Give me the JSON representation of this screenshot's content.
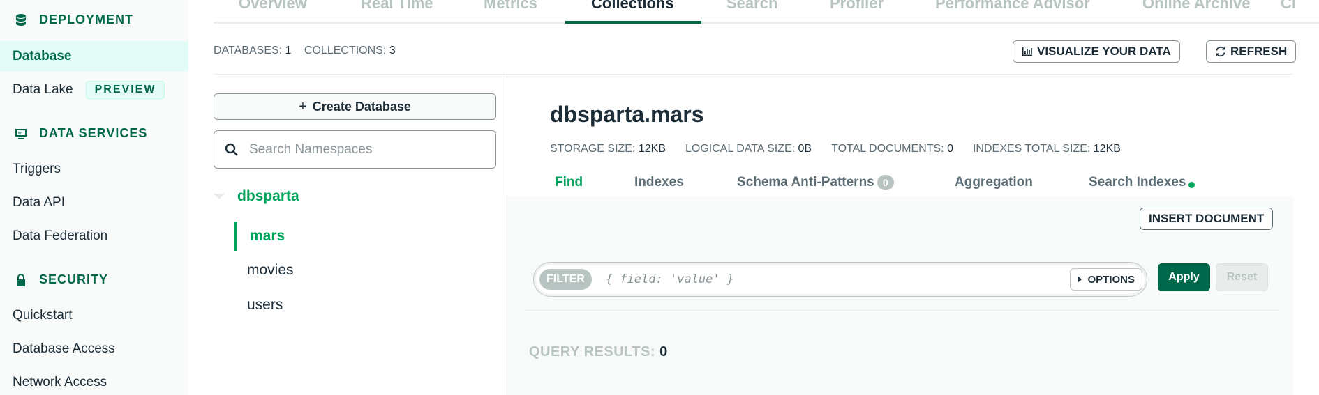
{
  "sidebar": {
    "sections": [
      {
        "label": "DEPLOYMENT",
        "icon": "database-icon"
      },
      {
        "label": "DATA SERVICES",
        "icon": "monitor-icon"
      },
      {
        "label": "SECURITY",
        "icon": "lock-icon"
      }
    ],
    "items": {
      "database": "Database",
      "data_lake": "Data Lake",
      "data_lake_badge": "PREVIEW",
      "triggers": "Triggers",
      "data_api": "Data API",
      "data_federation": "Data Federation",
      "quickstart": "Quickstart",
      "database_access": "Database Access",
      "network_access": "Network Access"
    }
  },
  "top_tabs": [
    "Overview",
    "Real Time",
    "Metrics",
    "Collections",
    "Search",
    "Profiler",
    "Performance Advisor",
    "Online Archive",
    "Cl"
  ],
  "active_top_tab": "Collections",
  "stats": {
    "databases_label": "DATABASES:",
    "databases_value": "1",
    "collections_label": "COLLECTIONS:",
    "collections_value": "3"
  },
  "actions": {
    "visualize": "VISUALIZE YOUR DATA",
    "refresh": "REFRESH"
  },
  "namespaces": {
    "create_label": "Create Database",
    "search_placeholder": "Search Namespaces",
    "database": "dbsparta",
    "collections": [
      "mars",
      "movies",
      "users"
    ],
    "active_collection": "mars"
  },
  "collection": {
    "title": "dbsparta.mars",
    "storage_label": "STORAGE SIZE:",
    "storage_value": "12KB",
    "logical_label": "LOGICAL DATA SIZE:",
    "logical_value": "0B",
    "docs_label": "TOTAL DOCUMENTS:",
    "docs_value": "0",
    "indexes_label": "INDEXES TOTAL SIZE:",
    "indexes_value": "12KB"
  },
  "sub_tabs": {
    "find": "Find",
    "indexes": "Indexes",
    "schema": "Schema Anti-Patterns",
    "schema_count": "0",
    "aggregation": "Aggregation",
    "search_indexes": "Search Indexes"
  },
  "query": {
    "insert_label": "INSERT DOCUMENT",
    "filter_label": "FILTER",
    "filter_placeholder": "{ field: 'value' }",
    "options_label": "OPTIONS",
    "apply_label": "Apply",
    "reset_label": "Reset",
    "results_label": "QUERY RESULTS:",
    "results_value": "0"
  },
  "colors": {
    "brand_green": "#00684a",
    "accent_green": "#00a35c",
    "muted": "#b8c4c2"
  }
}
